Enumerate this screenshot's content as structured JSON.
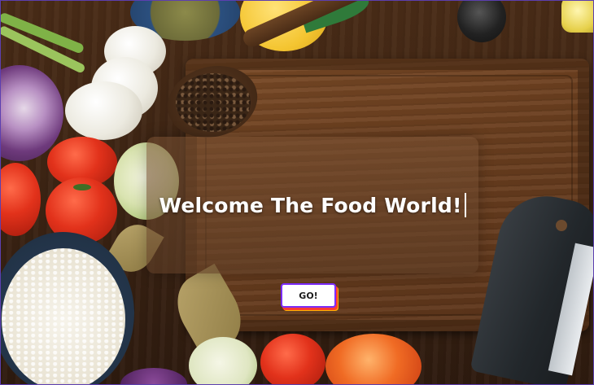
{
  "hero": {
    "title": "Welcome The Food World!"
  },
  "actions": {
    "go_label": "GO!"
  },
  "colors": {
    "go_button_border": "#7b2cff",
    "go_button_shadow": "#ff3d2e",
    "hero_text": "#ffffff"
  }
}
